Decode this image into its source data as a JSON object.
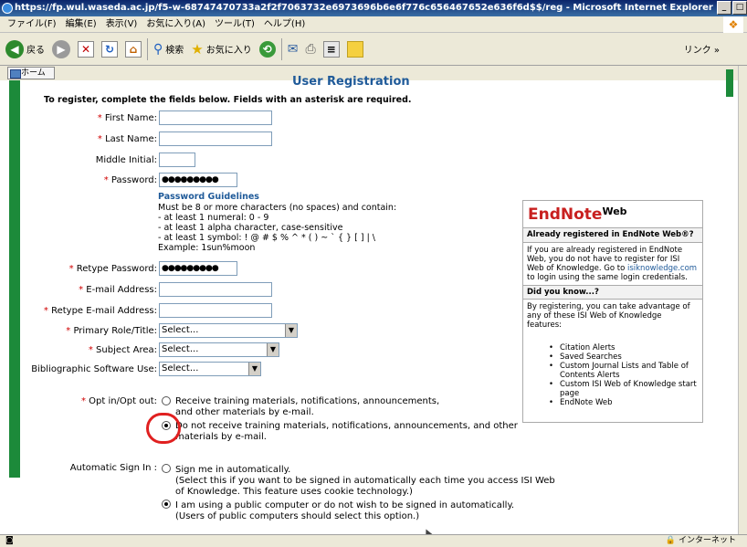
{
  "window": {
    "title": "https://fp.wul.waseda.ac.jp/f5-w-68747470733a2f2f7063732e6973696b6e6f776c656467652e636f6d$$/reg - Microsoft Internet Explorer",
    "controls": [
      "_",
      "□"
    ]
  },
  "menu": [
    "ファイル(F)",
    "編集(E)",
    "表示(V)",
    "お気に入り(A)",
    "ツール(T)",
    "ヘルプ(H)"
  ],
  "toolbar": {
    "back": "戻る",
    "search": "検索",
    "favorites": "お気に入り",
    "links": "リンク"
  },
  "tab": {
    "home": "ホーム"
  },
  "status": {
    "zone": "インターネット"
  },
  "page": {
    "heading": "User Registration",
    "intro": "To register, complete the fields below.  Fields with an asterisk are required.",
    "asterisk": "*",
    "fields": {
      "first_name": {
        "label": "First Name:",
        "value": ""
      },
      "last_name": {
        "label": "Last Name:",
        "value": ""
      },
      "middle_initial": {
        "label": "Middle Initial:",
        "value": ""
      },
      "password": {
        "label": "Password:",
        "value": "●●●●●●●●●"
      },
      "retype_password": {
        "label": "Retype Password:",
        "value": "●●●●●●●●●"
      },
      "email": {
        "label": "E-mail Address:",
        "value": ""
      },
      "retype_email": {
        "label": "Retype E-mail Address:",
        "value": ""
      },
      "primary_role": {
        "label": "Primary Role/Title:",
        "value": "Select..."
      },
      "subject_area": {
        "label": "Subject Area:",
        "value": "Select..."
      },
      "biblio_software": {
        "label": "Bibliographic Software Use:",
        "value": "Select..."
      }
    },
    "password_guidelines": {
      "title": "Password Guidelines",
      "lines": [
        "Must be 8 or more characters (no spaces) and contain:",
        "- at least 1 numeral: 0 - 9",
        "- at least 1 alpha character, case-sensitive",
        "- at least 1 symbol: ! @ # $ % ^ * ( ) ~ ` { } [ ] | \\",
        "Example: 1sun%moon"
      ]
    },
    "opt": {
      "label": "Opt in/Opt out:",
      "option_in": [
        "Receive training materials, notifications, announcements,",
        "and other materials by e-mail."
      ],
      "option_out": [
        "Do not receive training materials, notifications, announcements, and other",
        "materials by e-mail."
      ],
      "selected": "out"
    },
    "auto_signin": {
      "label": "Automatic Sign In :",
      "option_auto": [
        "Sign me in automatically.",
        "(Select this if you want to be signed in automatically each time you access ISI Web",
        "of Knowledge. This feature uses cookie technology.)"
      ],
      "option_public": [
        "I am using a public computer or do not wish to be signed in automatically.",
        "(Users of public computers should select this option.)"
      ],
      "selected": "public"
    }
  },
  "sidebar": {
    "brand": "EndNote",
    "brand_suffix": "Web",
    "already_title": "Already registered in EndNote Web®?",
    "already_text_1": "If you are already registered in EndNote Web, you do not have to register for ISI Web of Knowledge. Go to ",
    "already_link": "isiknowledge.com",
    "already_text_2": " to login using the same login credentials.",
    "didyouknow_title": "Did you know...?",
    "didyouknow_text": "By registering, you can take advantage of any of these ISI Web of Knowledge features:",
    "features": [
      "Citation Alerts",
      "Saved Searches",
      "Custom Journal Lists and Table of Contents Alerts",
      "Custom ISI Web of Knowledge start page",
      "EndNote Web"
    ]
  }
}
